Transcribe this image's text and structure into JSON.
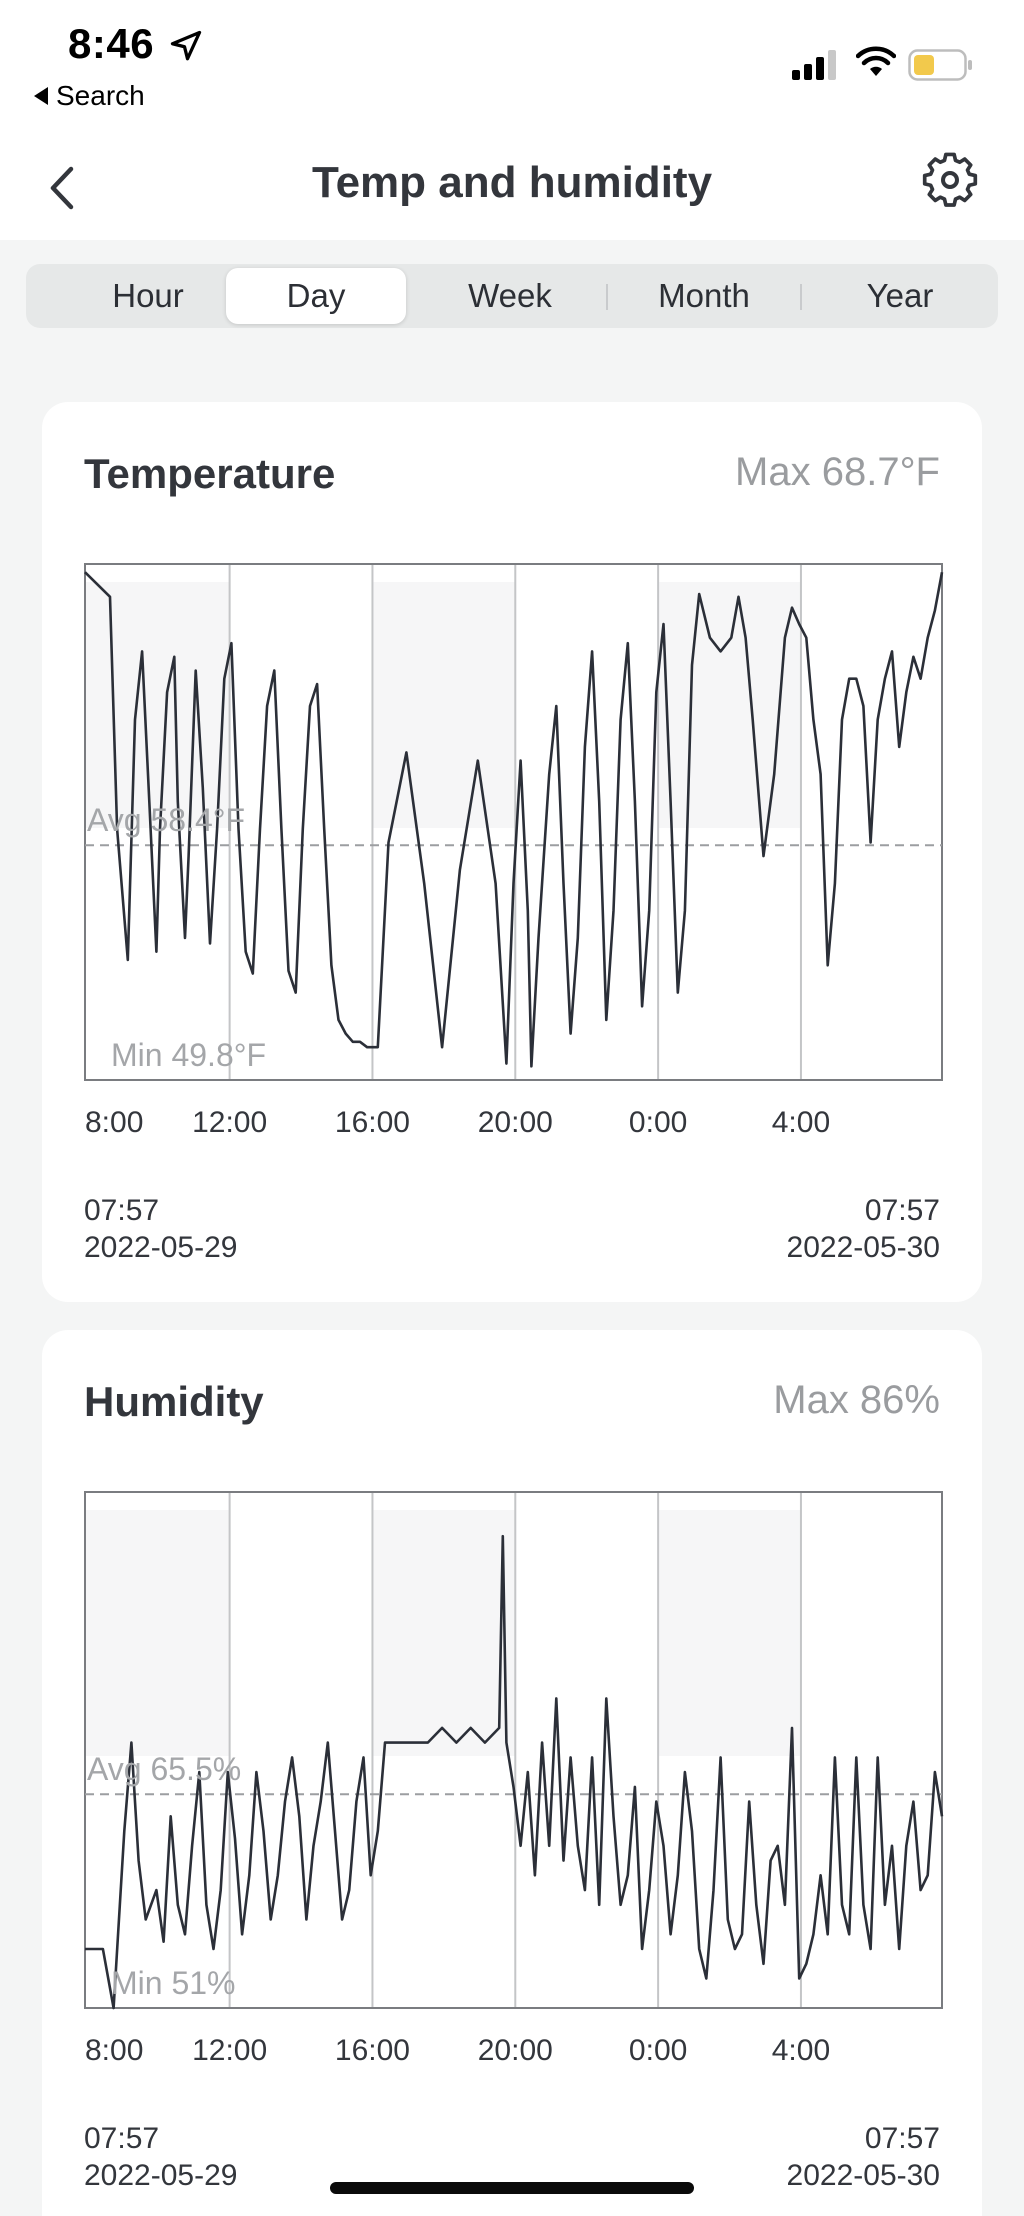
{
  "status_bar": {
    "time": "8:46",
    "back_app": "Search",
    "battery_color": "#f2c94c"
  },
  "header": {
    "title": "Temp and humidity"
  },
  "tabs": [
    {
      "label": "Hour",
      "active": false
    },
    {
      "label": "Day",
      "active": true
    },
    {
      "label": "Week",
      "active": false
    },
    {
      "label": "Month",
      "active": false
    },
    {
      "label": "Year",
      "active": false
    }
  ],
  "temperature": {
    "title": "Temperature",
    "max_label": "Max 68.7°F",
    "avg_label": "Avg 58.4°F",
    "min_label": "Min 49.8°F",
    "start_time": "07:57",
    "start_date": "2022-05-29",
    "end_time": "07:57",
    "end_date": "2022-05-30"
  },
  "humidity": {
    "title": "Humidity",
    "max_label": "Max 86%",
    "avg_label": "Avg 65.5%",
    "min_label": "Min 51%",
    "start_time": "07:57",
    "start_date": "2022-05-29",
    "end_time": "07:57",
    "end_date": "2022-05-30"
  },
  "chart_data": [
    {
      "type": "line",
      "ylim": [
        49.8,
        68.7
      ],
      "x_tick_labels": [
        "8:00",
        "12:00",
        "16:00",
        "20:00",
        "0:00",
        "4:00"
      ],
      "x_tick_hours": [
        0.05,
        4.05,
        8.05,
        12.05,
        16.05,
        20.05
      ],
      "avg": 58.4,
      "series": [
        {
          "x": [
            0,
            0.7,
            0.9,
            1.2,
            1.4,
            1.6,
            1.8,
            2.0,
            2.1,
            2.3,
            2.5,
            2.6,
            2.8,
            2.9,
            3.1,
            3.3,
            3.5,
            3.7,
            3.9,
            4.1,
            4.3,
            4.5,
            4.7,
            4.9,
            5.1,
            5.3,
            5.5,
            5.7,
            5.9,
            6.1,
            6.3,
            6.5,
            6.7,
            6.9,
            7.1,
            7.3,
            7.5,
            7.7,
            7.9,
            8.0,
            8.2,
            8.5,
            9.0,
            9.5,
            10,
            10.5,
            11,
            11.5,
            11.8,
            12.0,
            12.2,
            12.4,
            12.5,
            12.7,
            13.0,
            13.2,
            13.4,
            13.6,
            13.8,
            14.0,
            14.2,
            14.4,
            14.6,
            14.8,
            15.0,
            15.2,
            15.4,
            15.6,
            15.8,
            16.0,
            16.2,
            16.4,
            16.6,
            16.8,
            17.0,
            17.2,
            17.5,
            17.8,
            18.1,
            18.3,
            18.5,
            18.7,
            19.0,
            19.3,
            19.6,
            19.8,
            20.0,
            20.2,
            20.4,
            20.6,
            20.8,
            21.0,
            21.2,
            21.4,
            21.6,
            21.8,
            22.0,
            22.2,
            22.4,
            22.6,
            22.8,
            23.0,
            23.2,
            23.4,
            23.6,
            23.8,
            24.0
          ],
          "y": [
            68.4,
            67.5,
            59,
            54.2,
            63,
            65.5,
            60,
            54.5,
            59,
            64,
            65.3,
            60,
            55,
            58,
            64.8,
            60.5,
            54.8,
            59,
            64.5,
            65.8,
            59,
            54.5,
            53.7,
            59,
            63.5,
            64.8,
            59,
            53.8,
            53,
            59,
            63.5,
            64.3,
            59,
            54,
            52,
            51.5,
            51.2,
            51.2,
            51.0,
            51.0,
            51.0,
            58.5,
            61.8,
            57,
            51.0,
            57.5,
            61.5,
            57,
            50.4,
            57,
            61.5,
            56,
            50.3,
            55,
            61,
            63.5,
            57,
            51.5,
            55,
            62,
            65.5,
            60,
            52,
            56,
            63,
            65.8,
            60,
            52.5,
            56,
            64,
            66.5,
            60,
            53,
            56,
            65,
            67.6,
            66,
            65.5,
            66,
            67.5,
            66,
            63,
            58,
            61,
            66.0,
            67.1,
            66.5,
            66,
            63,
            61,
            54,
            57,
            63,
            64.5,
            64.5,
            63.5,
            58.5,
            63,
            64.5,
            65.5,
            62,
            64,
            65.3,
            64.5,
            66,
            67,
            68.4
          ]
        }
      ]
    },
    {
      "type": "line",
      "ylim": [
        51,
        86
      ],
      "x_tick_labels": [
        "8:00",
        "12:00",
        "16:00",
        "20:00",
        "0:00",
        "4:00"
      ],
      "x_tick_hours": [
        0.05,
        4.05,
        8.05,
        12.05,
        16.05,
        20.05
      ],
      "avg": 65.5,
      "series": [
        {
          "x": [
            0,
            0.3,
            0.5,
            0.8,
            1.1,
            1.3,
            1.5,
            1.7,
            2.0,
            2.2,
            2.4,
            2.6,
            2.8,
            3.0,
            3.2,
            3.4,
            3.6,
            3.8,
            4.0,
            4.2,
            4.4,
            4.6,
            4.8,
            5.0,
            5.2,
            5.4,
            5.6,
            5.8,
            6.0,
            6.2,
            6.4,
            6.6,
            6.8,
            7.0,
            7.2,
            7.4,
            7.6,
            7.8,
            8.0,
            8.2,
            8.4,
            8.8,
            9.2,
            9.6,
            10,
            10.4,
            10.8,
            11.2,
            11.6,
            11.7,
            11.8,
            12.0,
            12.2,
            12.4,
            12.6,
            12.8,
            13.0,
            13.2,
            13.4,
            13.6,
            13.8,
            14.0,
            14.2,
            14.4,
            14.6,
            14.8,
            15.0,
            15.2,
            15.4,
            15.6,
            15.8,
            16.0,
            16.2,
            16.4,
            16.6,
            16.8,
            17.0,
            17.2,
            17.4,
            17.6,
            17.8,
            18.0,
            18.2,
            18.4,
            18.6,
            18.8,
            19.0,
            19.2,
            19.4,
            19.6,
            19.8,
            20.0,
            20.2,
            20.4,
            20.6,
            20.8,
            21.0,
            21.2,
            21.4,
            21.6,
            21.8,
            22.0,
            22.2,
            22.4,
            22.6,
            22.8,
            23.0,
            23.2,
            23.4,
            23.6,
            23.8,
            24.0
          ],
          "y": [
            55,
            55,
            55,
            51,
            63,
            69,
            61,
            57,
            59,
            55.5,
            64,
            58,
            56,
            62,
            67,
            58,
            55,
            59,
            67,
            62.5,
            56,
            60,
            67,
            63,
            57,
            60,
            65,
            68,
            64,
            57,
            62,
            65,
            69,
            63,
            57,
            59,
            65,
            68,
            60,
            63,
            69,
            69,
            69,
            69,
            70,
            69,
            70,
            69,
            70,
            83,
            69,
            66,
            62,
            67,
            60,
            69,
            62,
            72,
            61,
            68,
            62,
            59,
            68,
            58,
            72,
            64,
            58,
            60,
            66,
            55,
            59,
            65,
            62,
            56,
            60,
            67,
            63,
            55,
            53,
            59,
            68,
            57,
            55,
            56,
            65,
            58,
            54,
            61,
            62,
            58,
            70,
            53,
            54,
            56,
            60,
            56,
            68,
            58,
            56,
            68,
            58,
            55,
            68,
            58,
            62,
            55,
            62,
            65,
            59,
            60,
            67,
            64
          ]
        }
      ]
    }
  ]
}
